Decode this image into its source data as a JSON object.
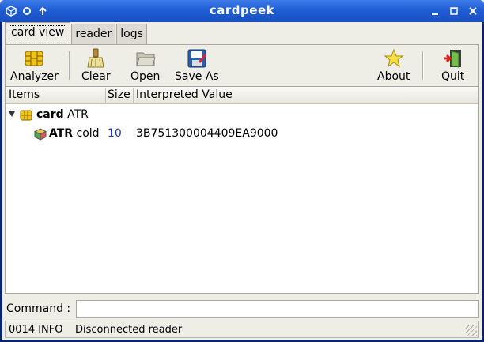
{
  "window": {
    "title": "cardpeek"
  },
  "tabs": [
    {
      "label": "card view",
      "active": true
    },
    {
      "label": "reader",
      "active": false
    },
    {
      "label": "logs",
      "active": false
    }
  ],
  "toolbar": {
    "analyzer": "Analyzer",
    "clear": "Clear",
    "open": "Open",
    "save_as": "Save As",
    "about": "About",
    "quit": "Quit"
  },
  "tree": {
    "columns": [
      "Items",
      "Size",
      "Interpreted Value"
    ],
    "rows": [
      {
        "bold": "card",
        "label": "ATR",
        "size": "",
        "value": ""
      },
      {
        "bold": "ATR",
        "label": "cold",
        "size": "10",
        "value": "3B751300004409EA9000"
      }
    ]
  },
  "command": {
    "label": "Command :",
    "value": ""
  },
  "status": {
    "code": "0014 INFO",
    "message": "Disconnected reader"
  },
  "colors": {
    "titlebar": "#1f5ed4",
    "size_text": "#1a3aa8"
  }
}
